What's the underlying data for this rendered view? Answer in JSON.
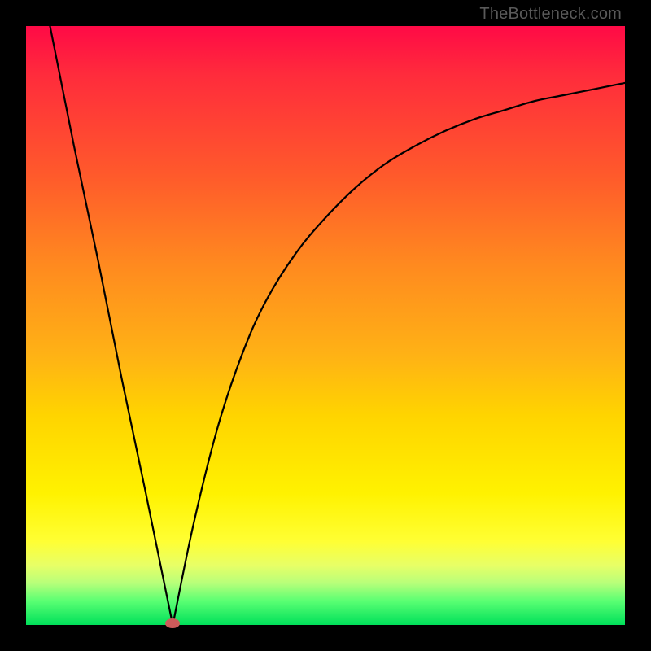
{
  "attribution": "TheBottleneck.com",
  "colors": {
    "frame": "#000000",
    "gradient_top": "#ff0a46",
    "gradient_mid1": "#ff8a1f",
    "gradient_mid2": "#ffe400",
    "gradient_bottom": "#00e05a",
    "curve": "#000000",
    "marker": "#cc5a5a"
  },
  "chart_data": {
    "type": "line",
    "title": "",
    "xlabel": "",
    "ylabel": "",
    "xlim": [
      0,
      100
    ],
    "ylim": [
      0,
      100
    ],
    "note": "Values read off the plot area where 0,0 is bottom-left. Minimum (0 bottleneck) at x≈24.5. Left branch is steep/linear toward top-left; right branch rises with diminishing slope toward top-right.",
    "series": [
      {
        "name": "curve",
        "x": [
          4,
          8,
          12,
          16,
          20,
          24.5,
          28,
          32,
          36,
          40,
          45,
          50,
          55,
          60,
          65,
          70,
          75,
          80,
          85,
          90,
          95,
          100
        ],
        "y": [
          100,
          80,
          61,
          41,
          22,
          0,
          17,
          33,
          45,
          54,
          62,
          68,
          73,
          77,
          80,
          82.5,
          84.5,
          86,
          87.5,
          88.5,
          89.5,
          90.5
        ]
      }
    ],
    "marker": {
      "x": 24.5,
      "y": 0
    }
  }
}
